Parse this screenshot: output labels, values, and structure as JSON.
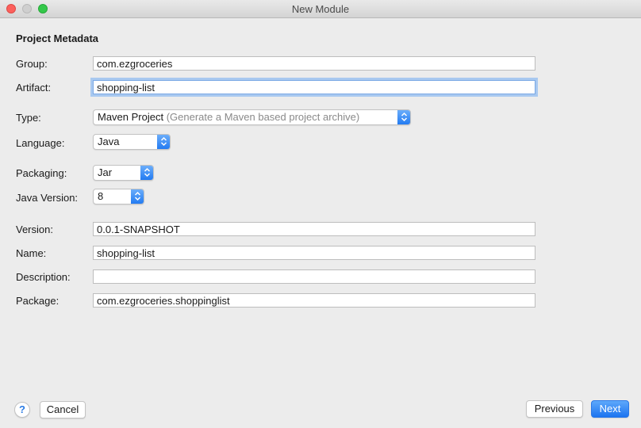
{
  "window": {
    "title": "New Module"
  },
  "section": {
    "title": "Project Metadata"
  },
  "fields": {
    "group": {
      "label": "Group:",
      "value": "com.ezgroceries"
    },
    "artifact": {
      "label": "Artifact:",
      "value": "shopping-list"
    },
    "type": {
      "label": "Type:",
      "value": "Maven Project",
      "hint": "(Generate a Maven based project archive)"
    },
    "language": {
      "label": "Language:",
      "value": "Java"
    },
    "packaging": {
      "label": "Packaging:",
      "value": "Jar"
    },
    "java_version": {
      "label": "Java Version:",
      "value": "8"
    },
    "version": {
      "label": "Version:",
      "value": "0.0.1-SNAPSHOT"
    },
    "name": {
      "label": "Name:",
      "value": "shopping-list"
    },
    "description": {
      "label": "Description:",
      "value": ""
    },
    "package": {
      "label": "Package:",
      "value": "com.ezgroceries.shoppinglist"
    }
  },
  "buttons": {
    "help": "?",
    "cancel": "Cancel",
    "previous": "Previous",
    "next": "Next"
  },
  "colors": {
    "accent": "#1c74f0",
    "close": "#fc605c",
    "maximize": "#34c84a"
  }
}
